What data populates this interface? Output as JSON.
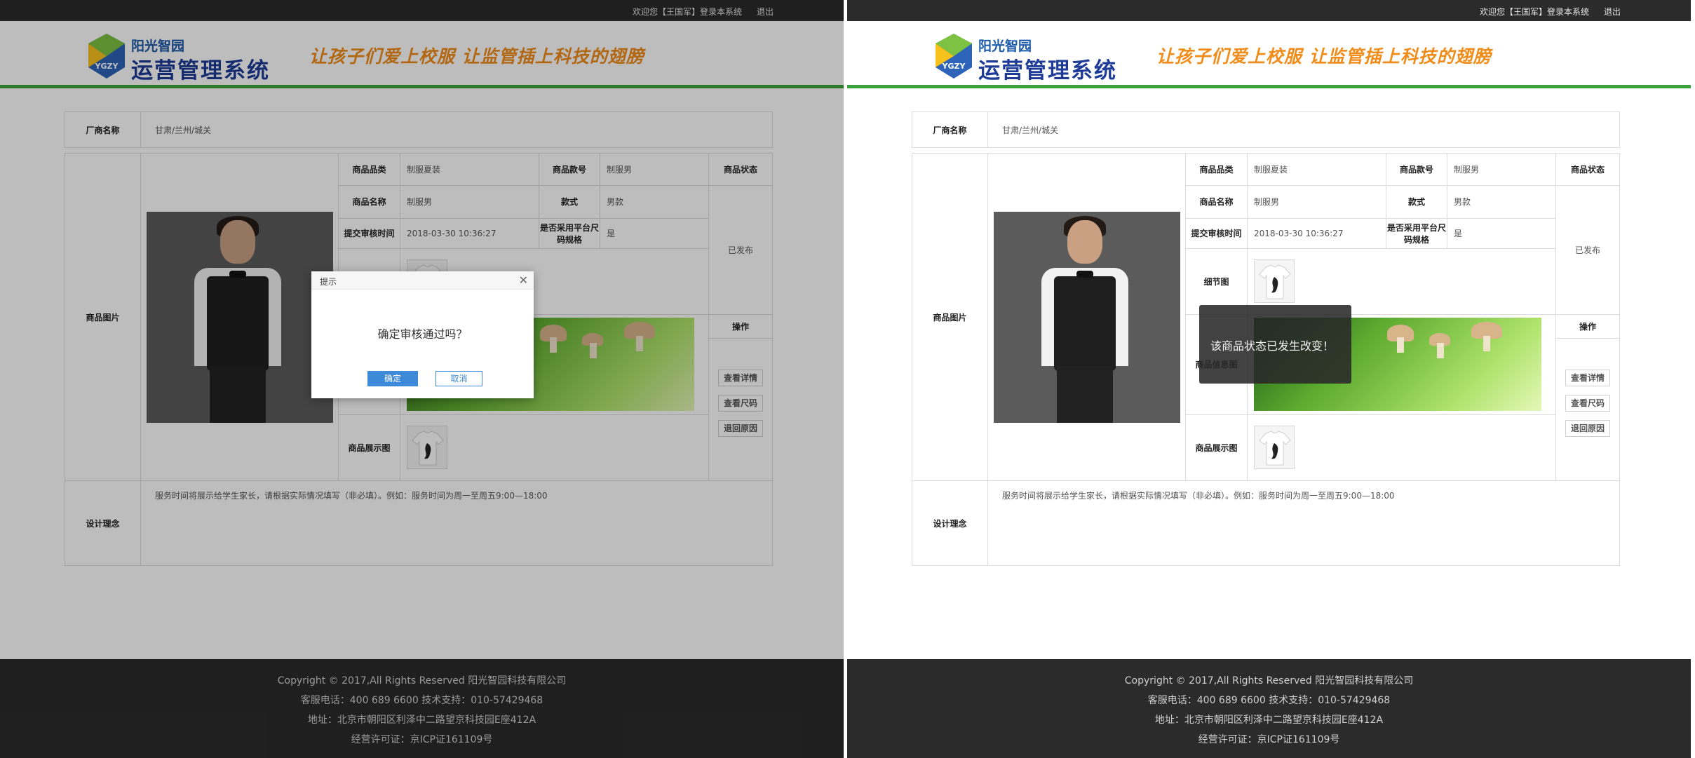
{
  "topbar": {
    "welcome": "欢迎您【王国军】登录本系统",
    "logout": "退出"
  },
  "header": {
    "logo_small": "阳光智园",
    "logo_title": "运营管理系统",
    "logo_badge": "YGZY",
    "slogan": "让孩子们爱上校服  让监管插上科技的翅膀"
  },
  "maker": {
    "label": "厂商名称",
    "value": "甘肃/兰州/城关"
  },
  "product": {
    "image_label": "商品图片",
    "category_label": "商品品类",
    "category_value": "制服夏装",
    "model_label": "商品款号",
    "model_value": "制服男",
    "status_label": "商品状态",
    "status_value": "已发布",
    "name_label": "商品名称",
    "name_value": "制服男",
    "style_label": "款式",
    "style_value": "男款",
    "submit_label": "提交审核时间",
    "submit_value": "2018-03-30 10:36:27",
    "platform_label": "是否采用平台尺码规格",
    "platform_value": "是",
    "detail_label": "细节图",
    "info_label": "商品信息图",
    "display_label": "商品展示图",
    "op_label": "操作",
    "op_buttons": [
      "查看详情",
      "查看尺码",
      "退回原因"
    ]
  },
  "design": {
    "label": "设计理念",
    "value": "服务时间将展示给学生家长，请根据实际情况填写（非必填）。例如：服务时间为周一至周五9:00—18:00"
  },
  "footer": {
    "copyright": "Copyright © 2017,All Rights Reserved 阳光智园科技有限公司",
    "phone": "客服电话：400 689 6600    技术支持：010-57429468",
    "address": "地址：北京市朝阳区利泽中二路望京科技园E座412A",
    "license": "经营许可证：京ICP证161109号"
  },
  "dialog": {
    "title": "提示",
    "message": "确定审核通过吗？",
    "ok": "确定",
    "cancel": "取消"
  },
  "toast": {
    "message": "该商品状态已发生改变！"
  },
  "colors": {
    "accent_green": "#3aa23d",
    "dark": "#2b2b2b",
    "primary_blue": "#3d8ad9",
    "slogan_orange": "#f08c1a"
  }
}
